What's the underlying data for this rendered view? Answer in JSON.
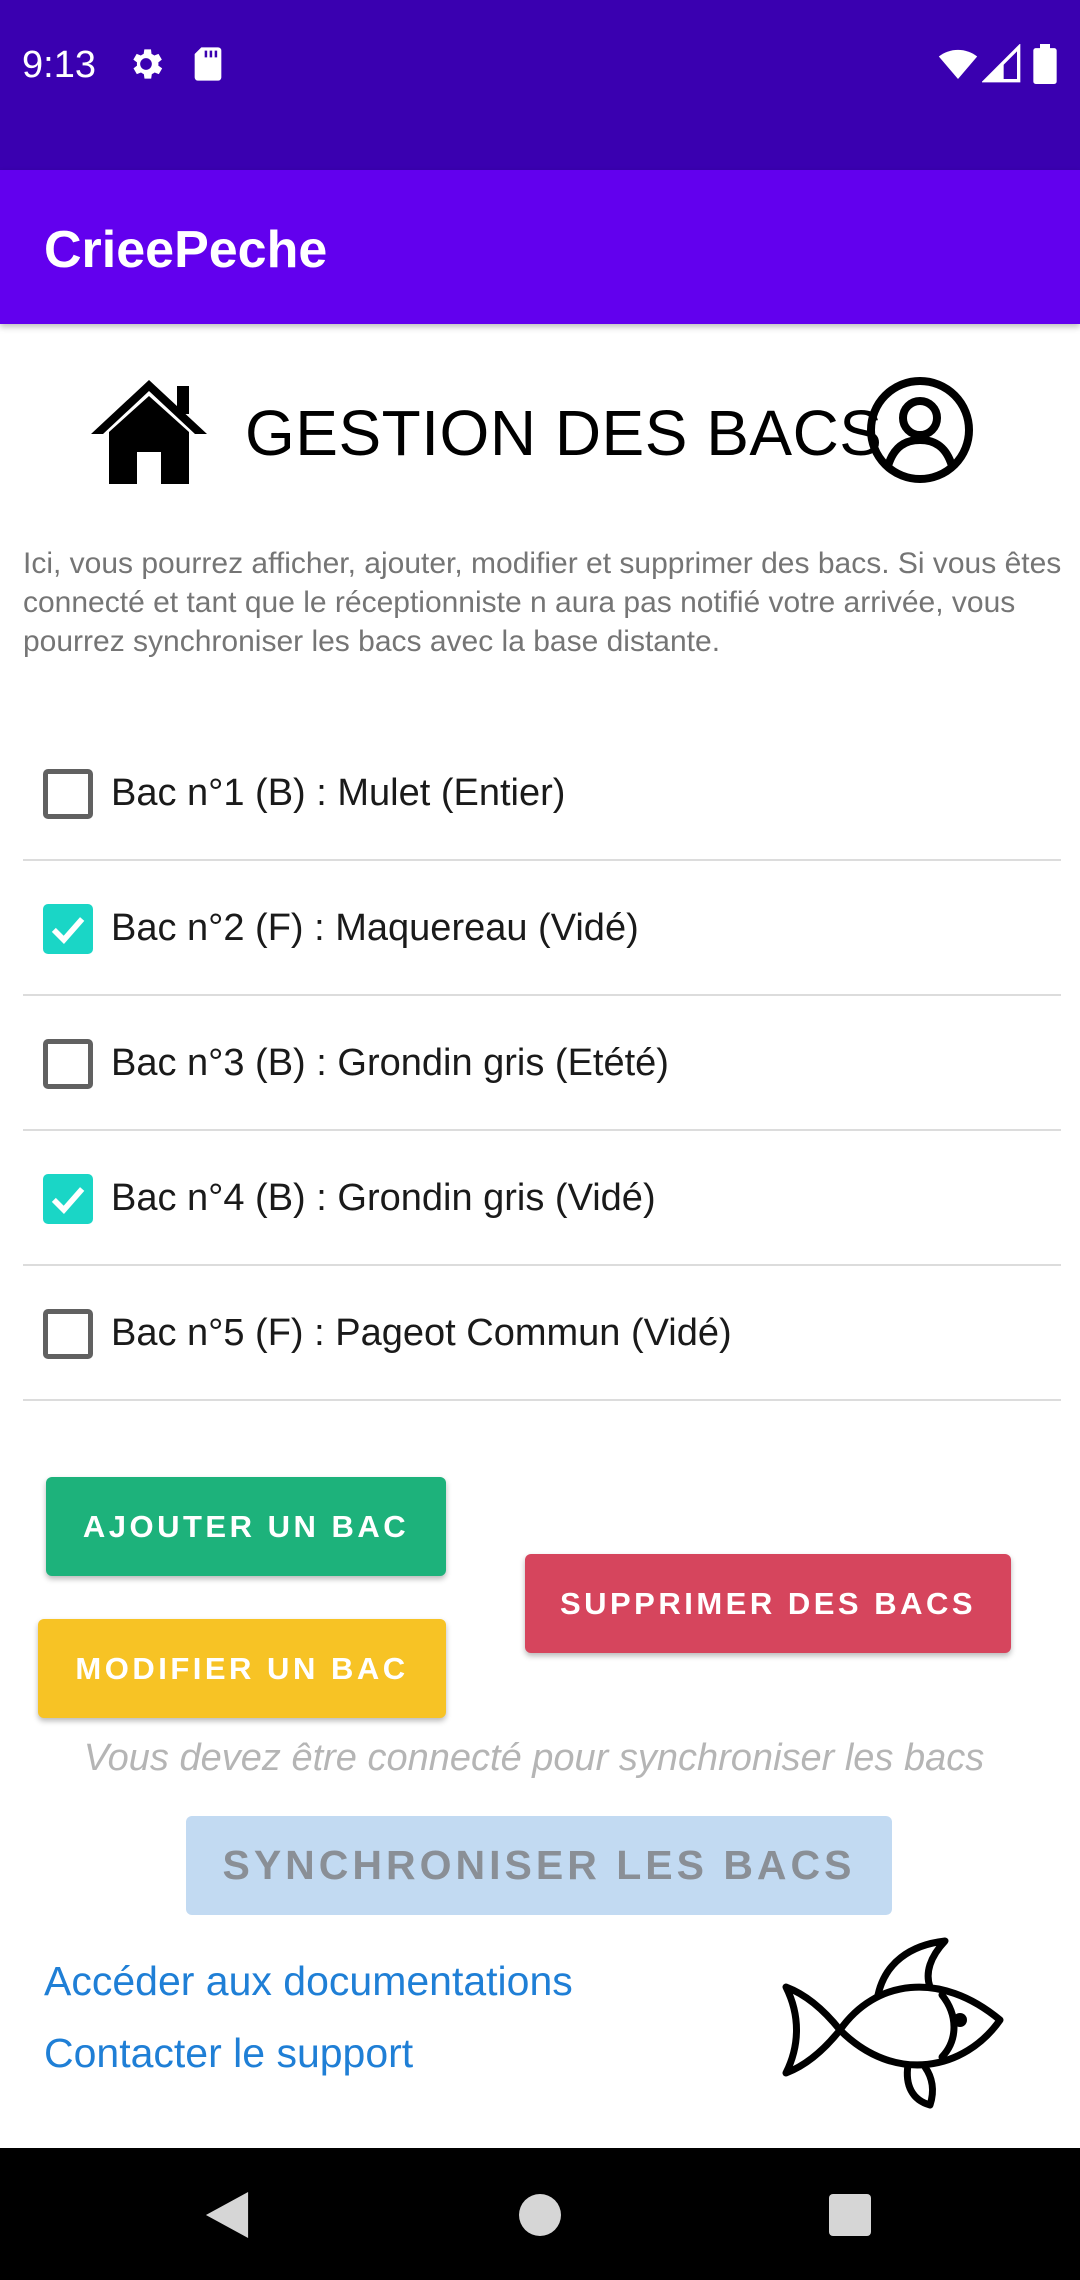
{
  "status_bar": {
    "time": "9:13",
    "left_icons": [
      "gear-icon",
      "sd-card-icon"
    ],
    "right_icons": [
      "wifi-icon",
      "signal-icon",
      "battery-icon"
    ]
  },
  "app_bar": {
    "title": "CrieePeche"
  },
  "header": {
    "title": "GESTION DES BACS",
    "left_icon": "home-icon",
    "right_icon": "user-account-icon"
  },
  "description": "Ici, vous pourrez afficher, ajouter, modifier et supprimer des bacs. Si vous êtes connecté et tant que le réceptionniste n aura pas notifié votre arrivée, vous pourrez synchroniser les bacs avec la base distante.",
  "bacs": [
    {
      "label": "Bac n°1 (B) : Mulet (Entier)",
      "checked": false
    },
    {
      "label": "Bac n°2 (F) : Maquereau (Vidé)",
      "checked": true
    },
    {
      "label": "Bac n°3 (B) : Grondin gris (Etété)",
      "checked": false
    },
    {
      "label": "Bac n°4 (B) : Grondin gris (Vidé)",
      "checked": true
    },
    {
      "label": "Bac n°5 (F) : Pageot Commun (Vidé)",
      "checked": false
    }
  ],
  "actions": {
    "add_label": "AJOUTER UN BAC",
    "edit_label": "MODIFIER UN BAC",
    "delete_label": "SUPPRIMER DES BACS"
  },
  "sync": {
    "note": "Vous devez être connecté pour synchroniser les bacs",
    "button_label": "SYNCHRONISER LES BACS",
    "enabled": false
  },
  "links": {
    "docs": "Accéder aux documentations",
    "support": "Contacter le support"
  },
  "decoration": {
    "footer_icon": "fish-icon"
  },
  "colors": {
    "status_bar": "#3a00b0",
    "app_bar": "#6200ee",
    "checkbox_checked": "#1ad6c6",
    "add_button": "#1db27b",
    "edit_button": "#f7c325",
    "delete_button": "#d6455d",
    "sync_button_disabled": "#c2daf2",
    "link": "#1f7fd6"
  },
  "nav_bar": {
    "icons": [
      "back-icon",
      "home-circle-icon",
      "recents-icon"
    ]
  }
}
